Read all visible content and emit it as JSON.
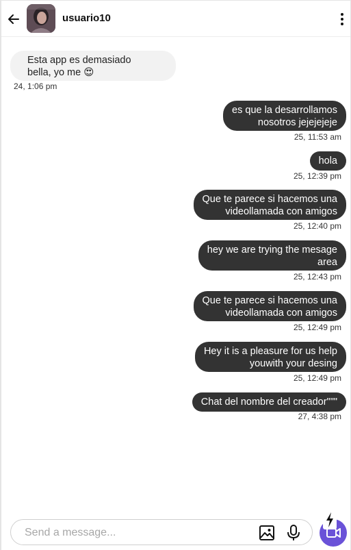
{
  "header": {
    "username": "usuario10"
  },
  "messages": [
    {
      "direction": "in",
      "lines": [
        "Esta app es demasiado",
        "bella, yo me 😍"
      ],
      "time": "24, 1:06 pm"
    },
    {
      "direction": "out",
      "lines": [
        "es que la desarrollamos",
        "nosotros jejejejeje"
      ],
      "time": "25, 11:53 am"
    },
    {
      "direction": "out",
      "lines": [
        "hola"
      ],
      "time": "25, 12:39 pm"
    },
    {
      "direction": "out",
      "lines": [
        "Que te parece si hacemos una",
        "videollamada con amigos"
      ],
      "time": "25, 12:40 pm"
    },
    {
      "direction": "out",
      "lines": [
        "hey we are trying the mesage",
        "area"
      ],
      "time": "25, 12:43 pm"
    },
    {
      "direction": "out",
      "lines": [
        "Que te parece si hacemos una",
        "videollamada con amigos"
      ],
      "time": "25, 12:49 pm"
    },
    {
      "direction": "out",
      "lines": [
        "Hey it is a pleasure for us help",
        "youwith your desing"
      ],
      "time": "25, 12:49 pm"
    },
    {
      "direction": "out",
      "lines": [
        "Chat del nombre del creador\"\"\""
      ],
      "time": "27, 4:38 pm"
    }
  ],
  "composer": {
    "placeholder": "Send a message...",
    "value": ""
  },
  "icons": {
    "back": "arrow-left-icon",
    "menu": "more-vertical-icon",
    "image": "image-icon",
    "mic": "microphone-icon",
    "video": "video-camera-icon",
    "bolt": "lightning-bolt-icon"
  },
  "colors": {
    "outgoing_bubble": "#333333",
    "incoming_bubble": "#f2f2f2",
    "accent": "#6a52d8"
  }
}
